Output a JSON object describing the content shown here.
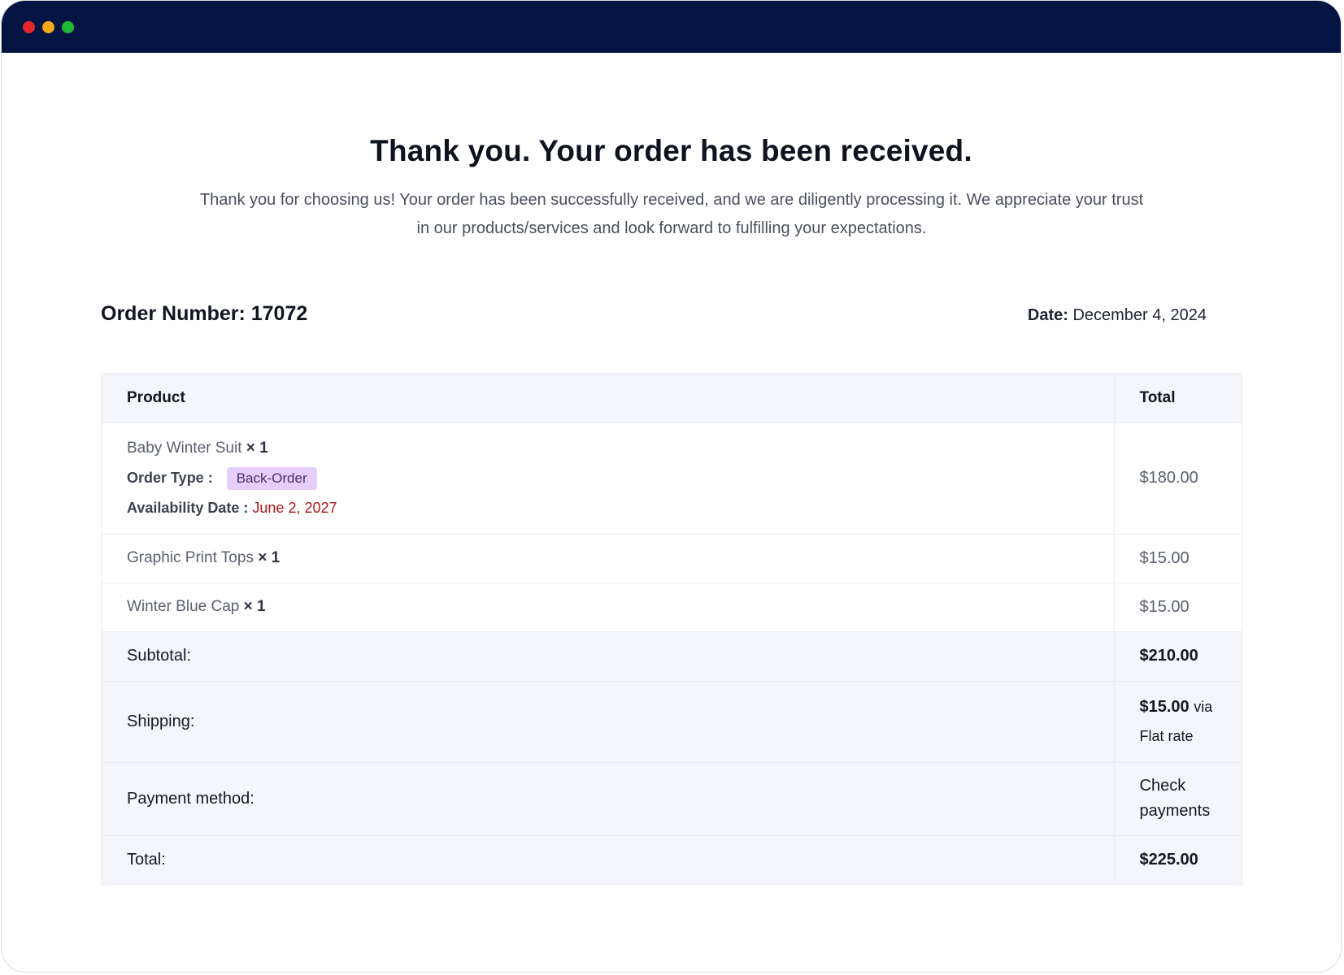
{
  "window": {
    "controls": {
      "close_color": "#e5242b",
      "minimize_color": "#f3a71a",
      "maximize_color": "#22b83a"
    },
    "titlebar_color": "#031442"
  },
  "page": {
    "heading": "Thank you. Your order has been received.",
    "intro": "Thank you for choosing us! Your order has been successfully received, and we are diligently processing it. We appreciate your trust in our products/services and look forward to fulfilling your expectations."
  },
  "order": {
    "number_label": "Order Number: 17072",
    "date_label": "Date:",
    "date_value": "December 4, 2024"
  },
  "table": {
    "headers": {
      "product": "Product",
      "total": "Total"
    },
    "items": [
      {
        "name": "Baby Winter Suit",
        "qty": "× 1",
        "total": "$180.00",
        "order_type_label": "Order Type :",
        "order_type_value": "Back-Order",
        "availability_label": "Availability Date :",
        "availability_value": "June 2, 2027"
      },
      {
        "name": "Graphic Print Tops",
        "qty": "× 1",
        "total": "$15.00"
      },
      {
        "name": "Winter Blue Cap",
        "qty": "× 1",
        "total": "$15.00"
      }
    ],
    "summary": {
      "subtotal_label": "Subtotal:",
      "subtotal_value": "$210.00",
      "shipping_label": "Shipping:",
      "shipping_value": "$15.00",
      "shipping_via": "via",
      "shipping_method": "Flat rate",
      "payment_label": "Payment method:",
      "payment_value": "Check payments",
      "total_label": "Total:",
      "total_value": "$225.00"
    }
  },
  "colors": {
    "badge_bg": "#e6cdfb",
    "availability_date": "#b0151a",
    "table_header_bg": "#f4f6fb"
  }
}
